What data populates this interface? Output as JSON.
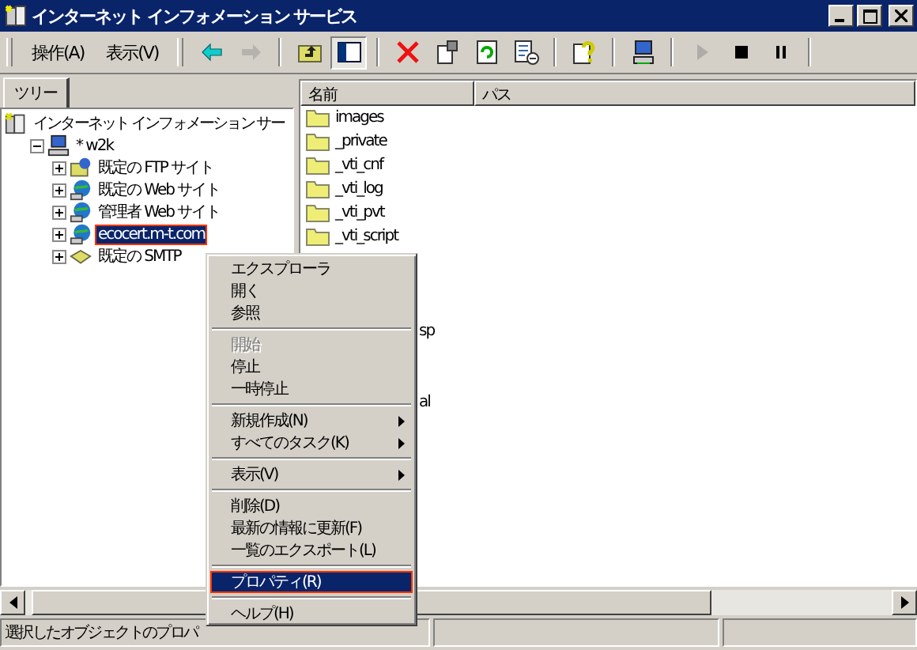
{
  "window": {
    "title": "インターネット インフォメーション サービス"
  },
  "menus": [
    "操作(A)",
    "表示(V)"
  ],
  "toolbar": [
    {
      "kind": "back",
      "disabled": false
    },
    {
      "kind": "forward",
      "disabled": true
    },
    {
      "kind": "sep"
    },
    {
      "kind": "up",
      "disabled": false
    },
    {
      "kind": "tree",
      "disabled": false,
      "pressed": true
    },
    {
      "kind": "sep"
    },
    {
      "kind": "delete",
      "disabled": false
    },
    {
      "kind": "properties",
      "disabled": false
    },
    {
      "kind": "refresh",
      "disabled": false
    },
    {
      "kind": "export",
      "disabled": false
    },
    {
      "kind": "sep"
    },
    {
      "kind": "help",
      "disabled": false
    },
    {
      "kind": "sep"
    },
    {
      "kind": "computer",
      "disabled": false
    },
    {
      "kind": "sep"
    },
    {
      "kind": "play",
      "disabled": true
    },
    {
      "kind": "stop",
      "disabled": false
    },
    {
      "kind": "pause",
      "disabled": false
    }
  ],
  "tree_tab": "ツリー",
  "tree": [
    {
      "label": "インターネット インフォメーション サー",
      "kind": "iis",
      "expanded": true,
      "selected": false,
      "highlighted": false,
      "children": [
        {
          "label": "* w2k",
          "kind": "computer",
          "expanded": true,
          "selected": false,
          "highlighted": false,
          "children": [
            {
              "label": "既定の FTP サイト",
              "kind": "ftp",
              "expanded": false,
              "selected": false,
              "highlighted": false
            },
            {
              "label": "既定の Web サイト",
              "kind": "web",
              "expanded": false,
              "selected": false,
              "highlighted": false
            },
            {
              "label": "管理者 Web サイト",
              "kind": "web",
              "expanded": false,
              "selected": false,
              "highlighted": false
            },
            {
              "label": "ecocert.m-t.com",
              "kind": "web",
              "expanded": false,
              "selected": true,
              "highlighted": true
            },
            {
              "label": "既定の SMTP",
              "kind": "smtp",
              "expanded": false,
              "selected": false,
              "highlighted": false
            }
          ]
        }
      ]
    }
  ],
  "columns": [
    "名前",
    "パス"
  ],
  "rows": [
    {
      "name": "images",
      "kind": "folder"
    },
    {
      "name": "_private",
      "kind": "folder"
    },
    {
      "name": "_vti_cnf",
      "kind": "folder"
    },
    {
      "name": "_vti_log",
      "kind": "folder"
    },
    {
      "name": "_vti_pvt",
      "kind": "folder"
    },
    {
      "name": "_vti_script",
      "kind": "folder"
    },
    {
      "name": "sp",
      "kind": "fragment"
    },
    {
      "name": "al",
      "kind": "fragment"
    }
  ],
  "status_bar": [
    "選択したオブジェクトのプロパ"
  ],
  "context_menu": [
    {
      "kind": "item",
      "label": "エクスプローラ",
      "disabled": false,
      "submenu": false,
      "selected": false,
      "highlighted": false
    },
    {
      "kind": "item",
      "label": "開く",
      "disabled": false,
      "submenu": false,
      "selected": false,
      "highlighted": false
    },
    {
      "kind": "item",
      "label": "参照",
      "disabled": false,
      "submenu": false,
      "selected": false,
      "highlighted": false
    },
    {
      "kind": "sep"
    },
    {
      "kind": "item",
      "label": "開始",
      "disabled": true,
      "submenu": false,
      "selected": false,
      "highlighted": false
    },
    {
      "kind": "item",
      "label": "停止",
      "disabled": false,
      "submenu": false,
      "selected": false,
      "highlighted": false
    },
    {
      "kind": "item",
      "label": "一時停止",
      "disabled": false,
      "submenu": false,
      "selected": false,
      "highlighted": false
    },
    {
      "kind": "sep"
    },
    {
      "kind": "item",
      "label": "新規作成(N)",
      "disabled": false,
      "submenu": true,
      "selected": false,
      "highlighted": false
    },
    {
      "kind": "item",
      "label": "すべてのタスク(K)",
      "disabled": false,
      "submenu": true,
      "selected": false,
      "highlighted": false
    },
    {
      "kind": "sep"
    },
    {
      "kind": "item",
      "label": "表示(V)",
      "disabled": false,
      "submenu": true,
      "selected": false,
      "highlighted": false
    },
    {
      "kind": "sep"
    },
    {
      "kind": "item",
      "label": "削除(D)",
      "disabled": false,
      "submenu": false,
      "selected": false,
      "highlighted": false
    },
    {
      "kind": "item",
      "label": "最新の情報に更新(F)",
      "disabled": false,
      "submenu": false,
      "selected": false,
      "highlighted": false
    },
    {
      "kind": "item",
      "label": "一覧のエクスポート(L)",
      "disabled": false,
      "submenu": false,
      "selected": false,
      "highlighted": false
    },
    {
      "kind": "sep"
    },
    {
      "kind": "item",
      "label": "プロパティ(R)",
      "disabled": false,
      "submenu": false,
      "selected": true,
      "highlighted": true
    },
    {
      "kind": "sep"
    },
    {
      "kind": "item",
      "label": "ヘルプ(H)",
      "disabled": false,
      "submenu": false,
      "selected": false,
      "highlighted": false
    }
  ]
}
